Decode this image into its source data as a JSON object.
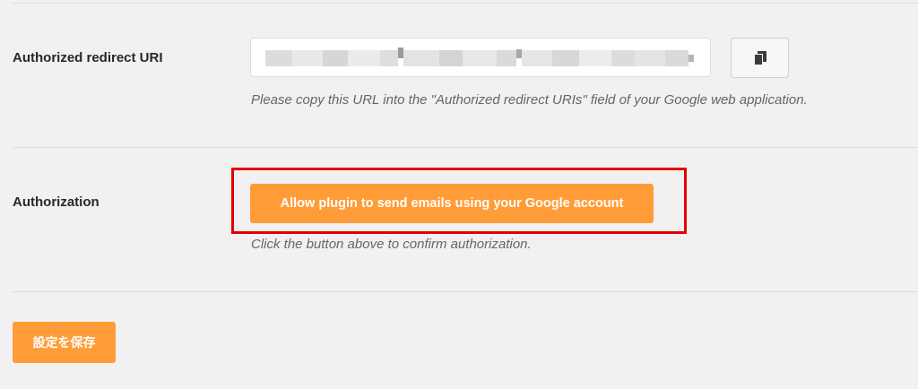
{
  "redirect_uri": {
    "label": "Authorized redirect URI",
    "value": "",
    "copy_button_icon": "copy-icon",
    "description": "Please copy this URL into the \"Authorized redirect URIs\" field of your Google web application."
  },
  "authorization": {
    "label": "Authorization",
    "button_label": "Allow plugin to send emails using your Google account",
    "description": "Click the button above to confirm authorization."
  },
  "footer": {
    "save_label": "設定を保存"
  },
  "colors": {
    "accent": "#ff9c38",
    "highlight": "#e50000",
    "page_bg": "#f1f1f1"
  }
}
